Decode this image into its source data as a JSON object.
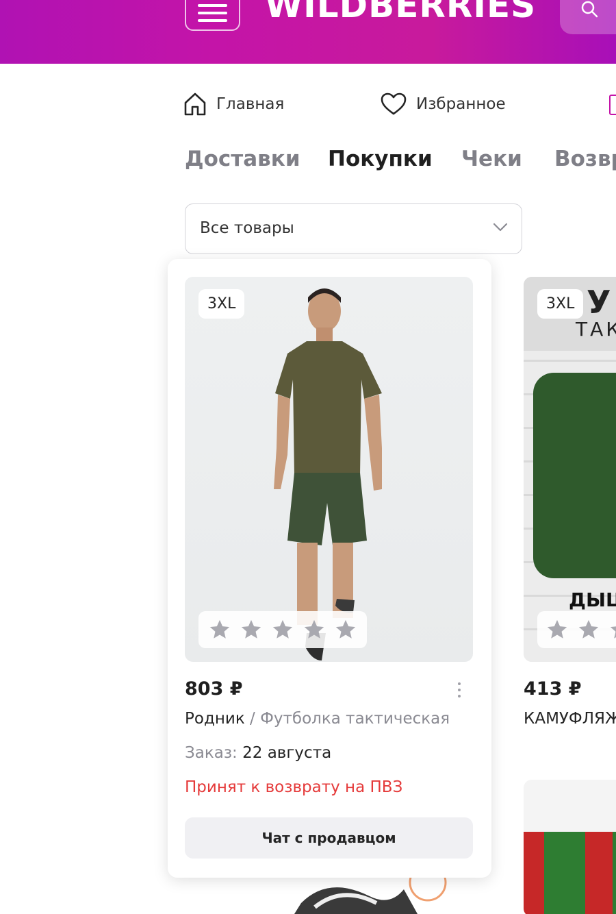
{
  "header": {
    "logo_text": "WILDBERRIES",
    "brand_color": "#c414a8"
  },
  "nav": {
    "items": [
      {
        "label": "Главная",
        "icon": "home-icon"
      },
      {
        "label": "Избранное",
        "icon": "heart-icon"
      }
    ]
  },
  "tabs": [
    {
      "label": "Доставки",
      "active": false
    },
    {
      "label": "Покупки",
      "active": true
    },
    {
      "label": "Чеки",
      "active": false
    },
    {
      "label": "Возвр",
      "active": false
    }
  ],
  "filter": {
    "selected": "Все товары"
  },
  "products": [
    {
      "size": "3XL",
      "price": "803 ₽",
      "brand": "Родник",
      "separator": "/",
      "name": "Футболка тактическая",
      "order_label": "Заказ:",
      "order_date": "22 августа",
      "status": "Принят к возврату на ПВЗ",
      "status_color": "#e53a3a",
      "chat_label": "Чат с продавцом",
      "rating": 0
    },
    {
      "size": "3XL",
      "price": "413 ₽",
      "name": "КАМУФЛЯЖ",
      "image_text_top": "У",
      "image_text_mid": "ТАК",
      "image_text_bottom": "ДЫШ"
    }
  ]
}
